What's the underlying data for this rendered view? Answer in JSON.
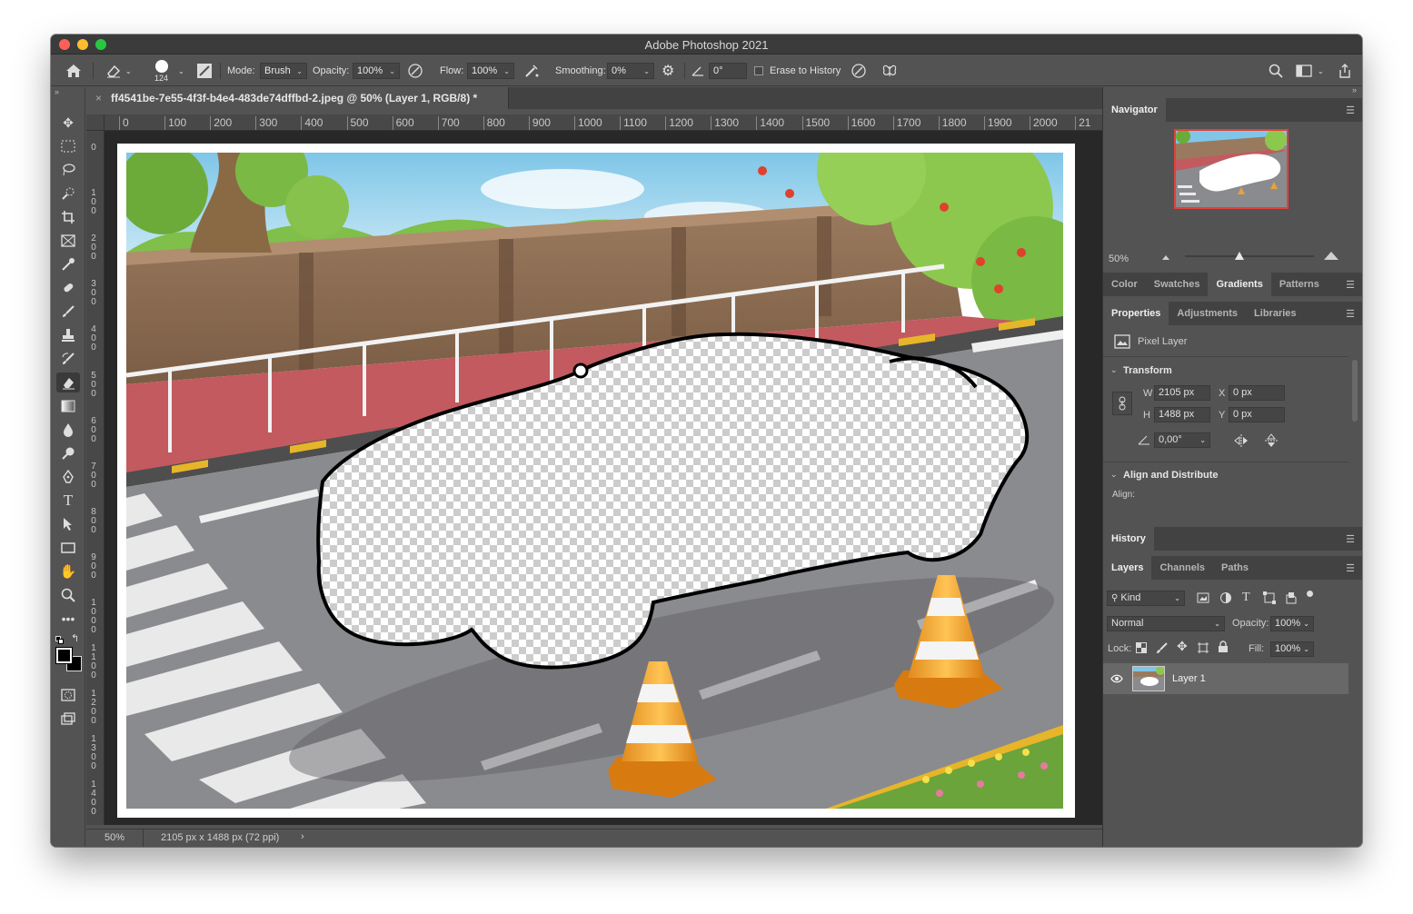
{
  "window": {
    "title": "Adobe Photoshop 2021"
  },
  "options_bar": {
    "brush_size": "124",
    "mode_label": "Mode:",
    "mode_value": "Brush",
    "opacity_label": "Opacity:",
    "opacity_value": "100%",
    "flow_label": "Flow:",
    "flow_value": "100%",
    "smoothing_label": "Smoothing:",
    "smoothing_value": "0%",
    "angle_value": "0°",
    "erase_history_label": "Erase to History",
    "erase_history_checked": false
  },
  "document": {
    "tab_title": "ff4541be-7e55-4f3f-b4e4-483de74dffbd-2.jpeg @ 50% (Layer 1, RGB/8) *",
    "close_glyph": "×"
  },
  "ruler": {
    "top_ticks": [
      "0",
      "100",
      "200",
      "300",
      "400",
      "500",
      "600",
      "700",
      "800",
      "900",
      "1000",
      "1100",
      "1200",
      "1300",
      "1400",
      "1500",
      "1600",
      "1700",
      "1800",
      "1900",
      "2000",
      "21"
    ],
    "left_ticks": [
      "0",
      "100",
      "200",
      "300",
      "400",
      "500",
      "600",
      "700",
      "800",
      "900",
      "1000",
      "1100",
      "1200",
      "1300",
      "1400"
    ]
  },
  "status": {
    "zoom": "50%",
    "doc_info": "2105 px x 1488 px (72 ppi)",
    "arrow": "›"
  },
  "navigator": {
    "title": "Navigator",
    "zoom": "50%"
  },
  "color_group": {
    "tabs": [
      "Color",
      "Swatches",
      "Gradients",
      "Patterns"
    ],
    "active": "Gradients"
  },
  "properties": {
    "tabs": [
      "Properties",
      "Adjustments",
      "Libraries"
    ],
    "active": "Properties",
    "layer_type": "Pixel Layer",
    "transform_title": "Transform",
    "w_label": "W",
    "w_value": "2105 px",
    "x_label": "X",
    "x_value": "0 px",
    "h_label": "H",
    "h_value": "1488 px",
    "y_label": "Y",
    "y_value": "0 px",
    "angle_value": "0,00°",
    "align_title": "Align and Distribute",
    "align_label": "Align:"
  },
  "history": {
    "title": "History"
  },
  "layers_panel": {
    "tabs": [
      "Layers",
      "Channels",
      "Paths"
    ],
    "active": "Layers",
    "filter_kind": "Kind",
    "blend_mode": "Normal",
    "opacity_label": "Opacity:",
    "opacity_value": "100%",
    "lock_label": "Lock:",
    "fill_label": "Fill:",
    "fill_value": "100%",
    "layers": [
      {
        "name": "Layer 1",
        "visible": true
      }
    ]
  },
  "colors": {
    "panel_bg": "#535353",
    "dark_bg": "#282828",
    "accent_red": "#e0413b"
  }
}
